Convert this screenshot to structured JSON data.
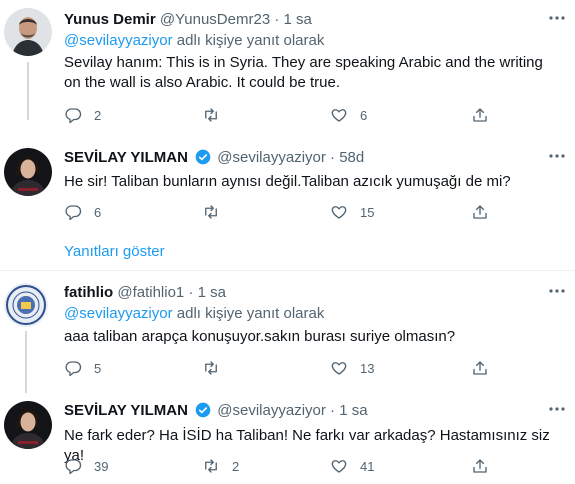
{
  "replying_suffix": "adlı kişiye yanıt olarak",
  "dot": "·",
  "show_replies": "Yanıtları göster",
  "colors": {
    "accent": "#1d9bf0",
    "muted": "#536471",
    "text": "#0f1419"
  },
  "icons": [
    "more-icon",
    "reply-icon",
    "retweet-icon",
    "like-icon",
    "share-icon",
    "verified-badge-icon"
  ],
  "tweets": [
    {
      "name": "Yunus Demir",
      "handle": "@YunusDemr23",
      "time": "1 sa",
      "reply_to": "@sevilayyaziyor",
      "text": "Sevilay hanım: This is in Syria. They are speaking Arabic and the writing on the wall is also Arabic. It could be true.",
      "replies": "2",
      "retweets": "",
      "likes": "6"
    },
    {
      "name": "SEVİLAY YILMAN",
      "handle": "@sevilayyaziyor",
      "time": "58d",
      "text": "He sir! Taliban bunların aynısı değil.Taliban azıcık yumuşağı de mi?",
      "replies": "6",
      "retweets": "",
      "likes": "15"
    },
    {
      "name": "fatihlio",
      "handle": "@fatihlio1",
      "time": "1 sa",
      "reply_to": "@sevilayyaziyor",
      "text": "aaa taliban arapça konuşuyor.sakın burası suriye olmasın?",
      "replies": "5",
      "retweets": "",
      "likes": "13"
    },
    {
      "name": "SEVİLAY YILMAN",
      "handle": "@sevilayyaziyor",
      "time": "1 sa",
      "text": "Ne fark eder? Ha İSİD ha Taliban! Ne farkı var arkadaş? Hastamısınız siz ya!",
      "replies": "39",
      "retweets": "2",
      "likes": "41"
    }
  ]
}
